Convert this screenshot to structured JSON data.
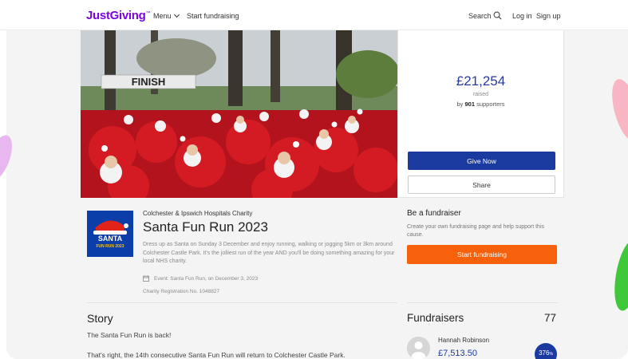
{
  "nav": {
    "logo": "JustGiving",
    "logo_tm": "™",
    "menu_label": "Menu",
    "start_fundraising": "Start fundraising",
    "search_label": "Search",
    "login_label": "Log in",
    "signup_label": "Sign up"
  },
  "hero": {
    "finish_banner": "FINISH"
  },
  "donation": {
    "amount": "£21,254",
    "raised_label": "raised",
    "supporters_prefix": "by",
    "supporters_count": "901",
    "supporters_suffix": "supporters",
    "give_now_label": "Give Now",
    "share_label": "Share"
  },
  "charity": {
    "logo_line1": "SANTA",
    "logo_line2": "FUN RUN 2023",
    "name": "Colchester & Ipswich Hospitals Charity",
    "event_title": "Santa Fun Run 2023",
    "description": "Dress up as Santa on Sunday 3 December and enjoy running, walking or jogging 5km or 3km around Colchester Castle Park. It's the jolliest run of the year AND you'll be doing something amazing for your local NHS charity.",
    "event_meta": "Event: Santa Fun Run, on December 3, 2023",
    "registration": "Charity Registration No. 1048827"
  },
  "story": {
    "title": "Story",
    "p1": "The Santa Fun Run is back!",
    "p2": "That's right, the 14th consecutive Santa Fun Run will return to Colchester Castle Park."
  },
  "be_fundraiser": {
    "title": "Be a fundraiser",
    "description": "Create your own fundraising page and help support this cause.",
    "button_label": "Start fundraising"
  },
  "fundraisers": {
    "title": "Fundraisers",
    "count": "77",
    "items": [
      {
        "name": "Hannah Robinson",
        "amount": "£7,513.50",
        "percent": "376",
        "percent_suffix": "%"
      }
    ]
  },
  "colors": {
    "brand_purple": "#7a04dd",
    "primary_blue": "#1a3aa0",
    "amount_blue": "#2a3a9c",
    "orange": "#f8610c"
  }
}
